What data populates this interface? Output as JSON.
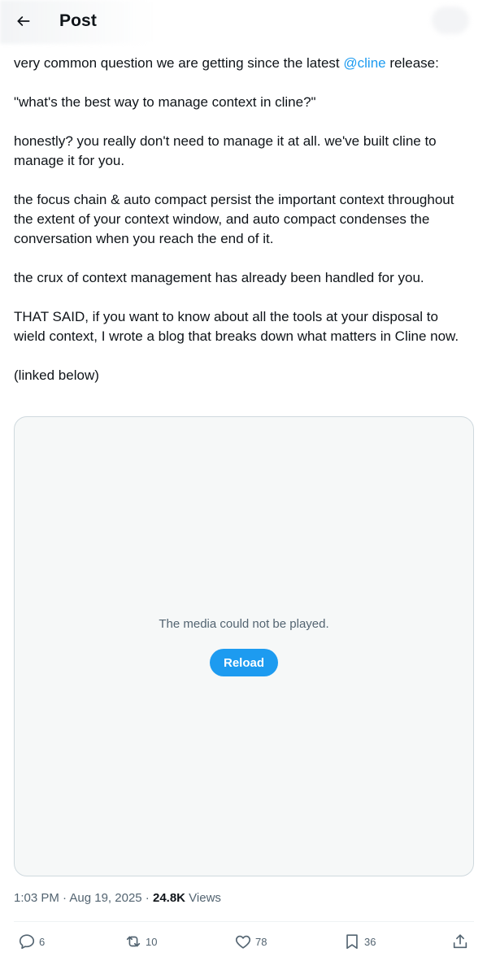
{
  "header": {
    "title": "Post"
  },
  "tweet": {
    "intro_prefix": "very common question we are getting since the latest ",
    "mention": "@cline",
    "intro_suffix": " release:",
    "paragraphs": [
      "\"what's the best way to manage context in cline?\"",
      "honestly? you really don't need to manage it at all. we've built cline to manage it for you.",
      "the focus chain & auto compact persist the important context throughout the extent of your context window, and auto compact condenses the conversation when you reach the end of it.",
      "the crux of context management has already been handled for you.",
      "THAT SAID, if you want to know about all the tools at your disposal to wield context, I wrote a blog that breaks down what matters in Cline now.",
      "(linked below)"
    ]
  },
  "media": {
    "message": "The media could not be played.",
    "reload_label": "Reload"
  },
  "meta": {
    "time": "1:03 PM",
    "separator": " · ",
    "date": "Aug 19, 2025",
    "views_count": "24.8K",
    "views_label": " Views"
  },
  "actions": {
    "replies": "6",
    "reposts": "10",
    "likes": "78",
    "bookmarks": "36"
  },
  "colors": {
    "accent": "#1d9bf0",
    "text_primary": "#0f1419",
    "text_secondary": "#536471",
    "media_bg": "#f6f8f8",
    "border": "#cfd9de"
  },
  "icons": {
    "back": "arrow-left-icon",
    "reply": "reply-bubble-icon",
    "repost": "repost-icon",
    "like": "heart-icon",
    "bookmark": "bookmark-icon",
    "share": "share-upload-icon"
  }
}
